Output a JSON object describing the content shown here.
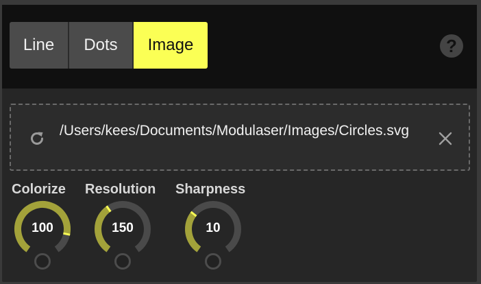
{
  "mode_tabs": [
    {
      "label": "Line",
      "selected": false
    },
    {
      "label": "Dots",
      "selected": false
    },
    {
      "label": "Image",
      "selected": true
    }
  ],
  "help_label": "?",
  "file": {
    "path": "/Users/kees/Documents/Modulaser/Images/Circles.svg",
    "reload_icon": "reload-icon",
    "clear_icon": "close-icon"
  },
  "knobs": [
    {
      "label": "Colorize",
      "value": "100",
      "level": 0.85
    },
    {
      "label": "Resolution",
      "value": "150",
      "level": 0.38
    },
    {
      "label": "Sharpness",
      "value": "10",
      "level": 0.32
    }
  ],
  "colors": {
    "accent": "#fbff55",
    "knob_fill": "#a3a23a",
    "knob_track": "#4a4a4a",
    "knob_marker": "#fbff55"
  }
}
